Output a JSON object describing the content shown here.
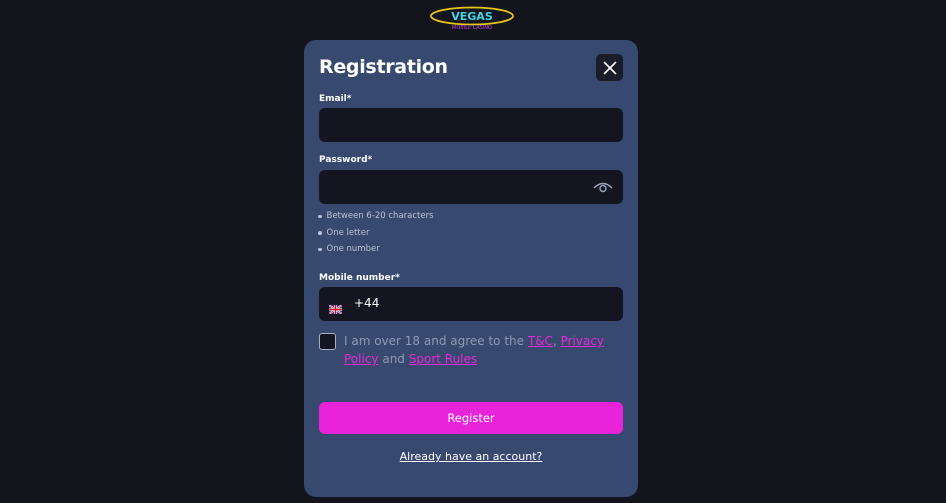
{
  "logo": {
    "text": "VEGAS",
    "subtext": "MOBILE CASINO"
  },
  "modal": {
    "title": "Registration",
    "email": {
      "label": "Email*",
      "value": ""
    },
    "password": {
      "label": "Password*",
      "value": "",
      "rules": [
        "Between 6-20 characters",
        "One letter",
        "One number"
      ]
    },
    "mobile": {
      "label": "Mobile number*",
      "dial_code": "+44",
      "country_flag": "uk-flag-icon",
      "value": ""
    },
    "consent": {
      "checked": false,
      "text_1": "I am over 18 and agree to the ",
      "link_tc": "T&C",
      "sep": ", ",
      "link_privacy": "Privacy Policy",
      "text_2": " and ",
      "link_sport": "Sport Rules"
    },
    "register_label": "Register",
    "signin_label": "Already have an account?"
  },
  "colors": {
    "background": "#13141c",
    "modal": "#37496f",
    "input": "#141520",
    "accent": "#e823d9"
  }
}
